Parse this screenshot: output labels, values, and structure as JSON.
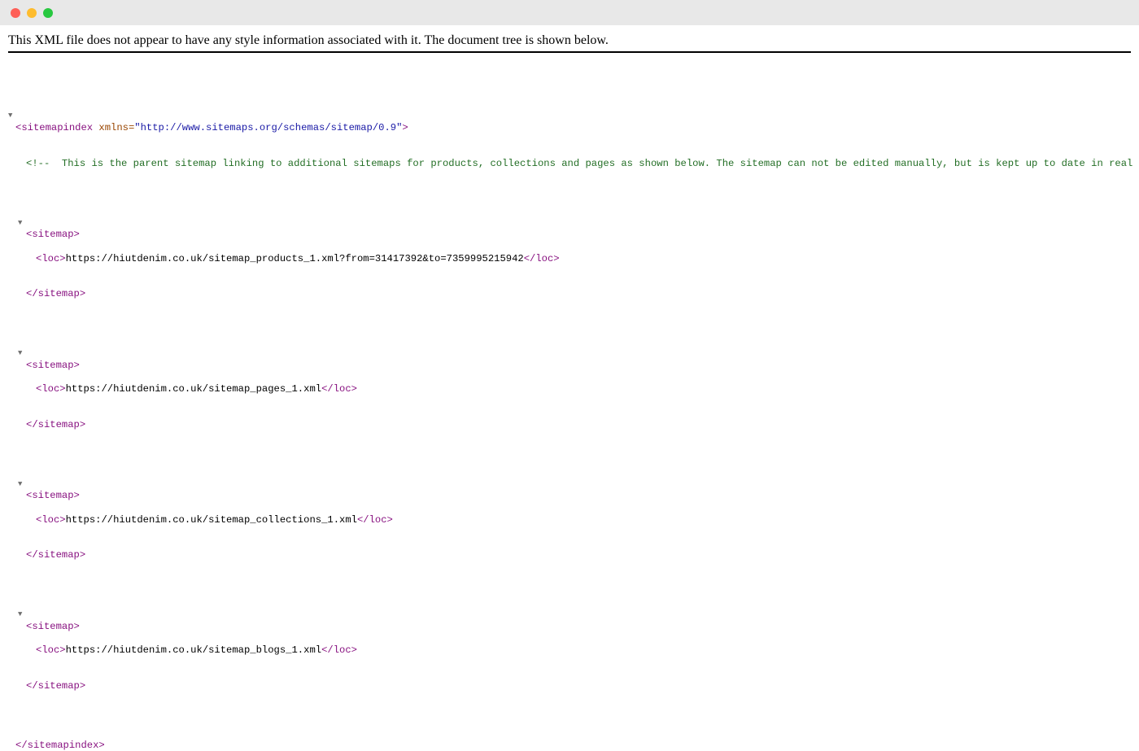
{
  "window": {
    "buttons": [
      {
        "name": "close",
        "color": "#fe5f57"
      },
      {
        "name": "minimize",
        "color": "#febc2e"
      },
      {
        "name": "zoom",
        "color": "#28c840"
      }
    ]
  },
  "info_banner": "This XML file does not appear to have any style information associated with it. The document tree is shown below.",
  "tree": {
    "root_open": "<sitemapindex",
    "root_attr_name": " xmlns=",
    "root_attr_value": "\"http://www.sitemaps.org/schemas/sitemap/0.9\"",
    "root_open_end": ">",
    "comment": "<!--  This is the parent sitemap linking to additional sitemaps for products, collections and pages as shown below. The sitemap can not be edited manually, but is kept up to date in real time.  -->",
    "sitemap_open": "<sitemap>",
    "sitemap_close": "</sitemap>",
    "loc_open": "<loc>",
    "loc_close": "</loc>",
    "locs": [
      "https://hiutdenim.co.uk/sitemap_products_1.xml?from=31417392&to=7359995215942",
      "https://hiutdenim.co.uk/sitemap_pages_1.xml",
      "https://hiutdenim.co.uk/sitemap_collections_1.xml",
      "https://hiutdenim.co.uk/sitemap_blogs_1.xml"
    ],
    "root_close": "</sitemapindex>",
    "toggle_glyph": "▼"
  }
}
